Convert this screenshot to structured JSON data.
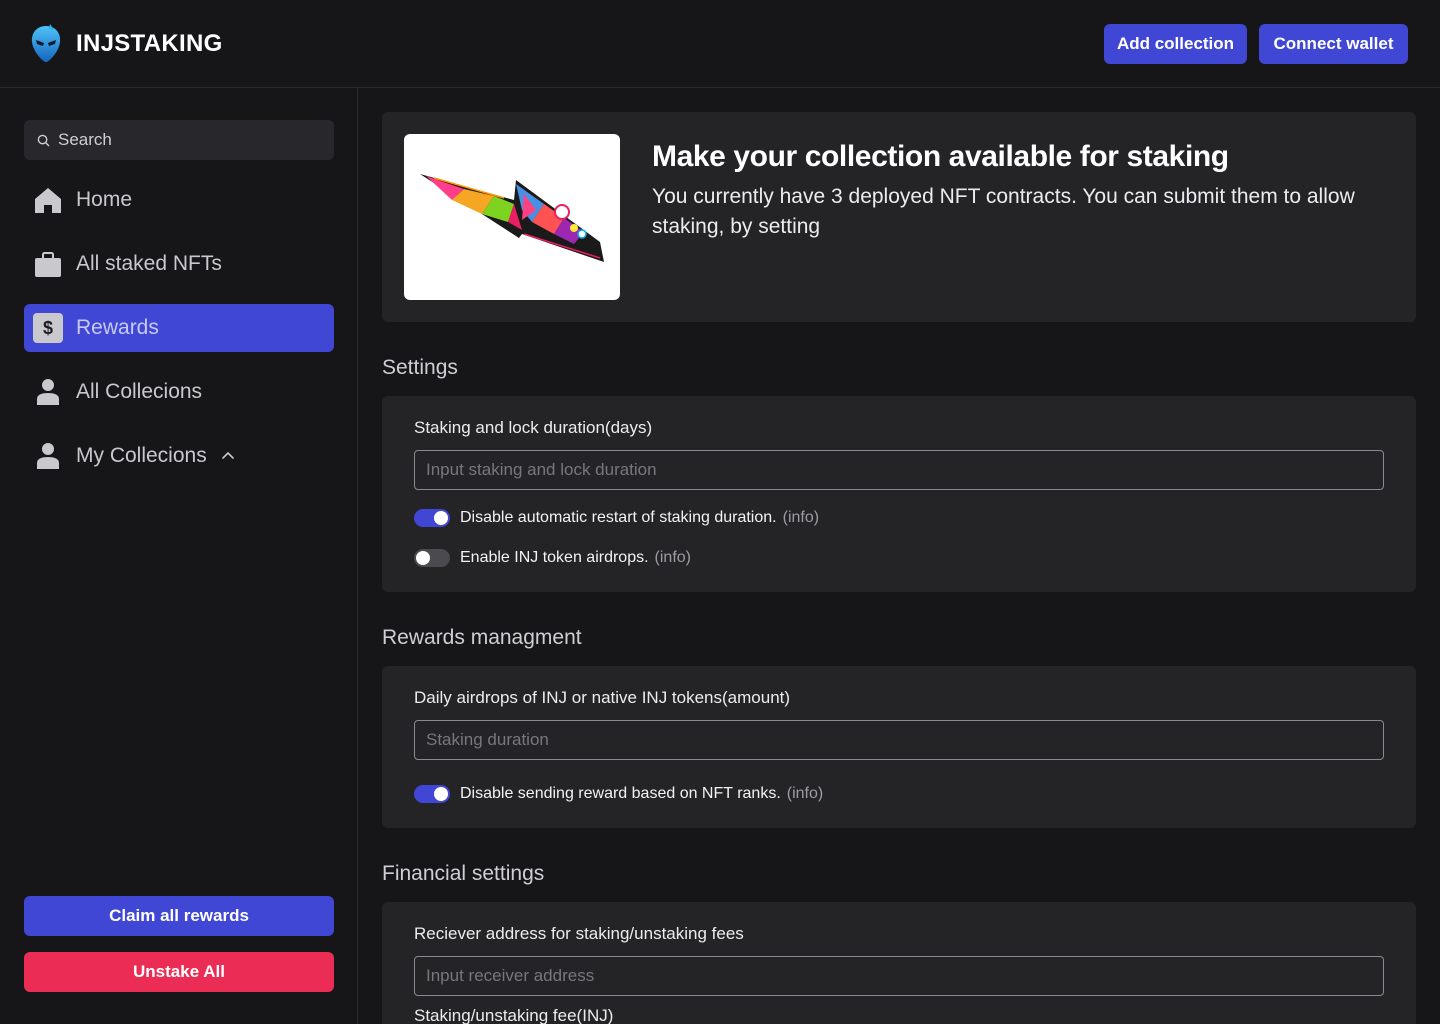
{
  "header": {
    "brand": "INJSTAKING",
    "add_collection": "Add collection",
    "connect_wallet": "Connect wallet"
  },
  "sidebar": {
    "search_placeholder": "Search",
    "items": [
      {
        "label": "Home",
        "icon": "home-icon"
      },
      {
        "label": "All staked NFTs",
        "icon": "briefcase-icon"
      },
      {
        "label": "Rewards",
        "icon": "dollar-icon",
        "active": true
      },
      {
        "label": "All Collecions",
        "icon": "user-icon"
      },
      {
        "label": "My Collecions",
        "icon": "user-icon",
        "expanded": true
      }
    ],
    "claim_all": "Claim all rewards",
    "unstake_all": "Unstake All"
  },
  "hero": {
    "title": "Make your collection available for staking",
    "description": "You currently have 3 deployed NFT contracts. You can submit them to allow staking, by setting"
  },
  "settings": {
    "title": "Settings",
    "duration_label": "Staking and lock duration(days)",
    "duration_placeholder": "Input staking and lock duration",
    "toggle1": {
      "label": "Disable automatic restart of staking duration.",
      "info": "(info)",
      "on": true
    },
    "toggle2": {
      "label": "Enable INJ token airdrops.",
      "info": "(info)",
      "on": false
    }
  },
  "rewards": {
    "title": "Rewards managment",
    "airdrop_label": "Daily airdrops of INJ or native INJ tokens(amount)",
    "airdrop_placeholder": "Staking duration",
    "toggle": {
      "label": "Disable sending reward based on NFT ranks.",
      "info": "(info)",
      "on": true
    }
  },
  "financial": {
    "title": "Financial settings",
    "receiver_label": "Reciever address for staking/unstaking fees",
    "receiver_placeholder": "Input receiver address",
    "fee_label": "Staking/unstaking fee(INJ)"
  },
  "colors": {
    "accent": "#4047d4",
    "danger": "#eb2d56",
    "background": "#161618",
    "card": "#242427"
  }
}
